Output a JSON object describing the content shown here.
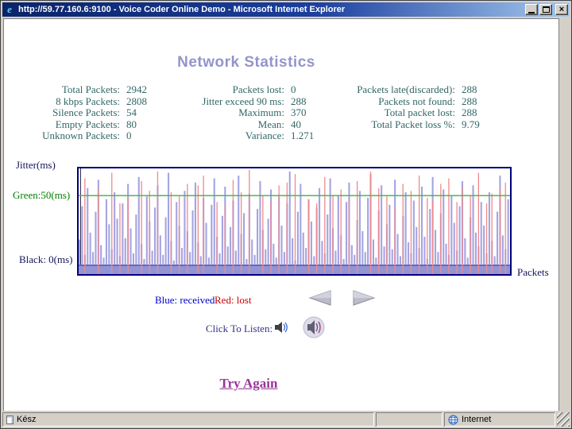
{
  "window": {
    "title": "http://59.77.160.6:9100 - Voice Coder Online Demo - Microsoft Internet Explorer",
    "controls": {
      "close_glyph": "×"
    },
    "icons": {
      "ie_logo_glyph": "e"
    }
  },
  "page": {
    "heading": "Network Statistics",
    "stats": {
      "group1": [
        {
          "label": "Total Packets:",
          "value": "2942"
        },
        {
          "label": "8 kbps Packets:",
          "value": "2808"
        },
        {
          "label": "Silence Packets:",
          "value": "54"
        },
        {
          "label": "Empty Packets:",
          "value": "80"
        },
        {
          "label": "Unknown Packets:",
          "value": "0"
        }
      ],
      "group2": [
        {
          "label": "Packets lost:",
          "value": "0"
        },
        {
          "label": "Jitter exceed 90 ms:",
          "value": "288"
        },
        {
          "label": "Maximum:",
          "value": "370"
        },
        {
          "label": "Mean:",
          "value": "40"
        },
        {
          "label": "Variance:",
          "value": "1.271"
        }
      ],
      "group3": [
        {
          "label": "Packets late(discarded):",
          "value": "288"
        },
        {
          "label": "Packets not found:",
          "value": "288"
        },
        {
          "label": "Total packet lost:",
          "value": "288"
        },
        {
          "label": "Total Packet loss %:",
          "value": "9.79"
        }
      ]
    },
    "chart_labels": {
      "y_axis": "Jitter(ms)",
      "green_ref": "Green:50(ms)",
      "black_ref": "Black: 0(ms)",
      "x_axis": "Packets"
    },
    "legend": {
      "received": "Blue: received",
      "lost": "Red: lost"
    },
    "listen_label": "Click To Listen:",
    "try_again_label": "Try Again"
  },
  "statusbar": {
    "status_text": "Kész",
    "zone_label": "Internet"
  },
  "chart_data": {
    "type": "bar",
    "description": "Per-packet jitter in ms; blue bars = received packets, red lines = lost packets",
    "ylabel": "Jitter(ms)",
    "xlabel": "Packets",
    "ylim": [
      0,
      68
    ],
    "reference_lines": [
      {
        "label": "Green:50(ms)",
        "value": 50,
        "color": "#4db84d"
      },
      {
        "label": "Black: 0(ms)",
        "value": 0,
        "color": "#000000"
      }
    ],
    "series": [
      {
        "name": "received",
        "color": "#9a9ae0",
        "values": [
          18,
          42,
          7,
          55,
          23,
          9,
          38,
          61,
          14,
          5,
          47,
          29,
          11,
          52,
          33,
          6,
          44,
          19,
          58,
          26,
          8,
          36,
          63,
          15,
          4,
          49,
          31,
          10,
          41,
          57,
          21,
          7,
          34,
          66,
          17,
          3,
          45,
          28,
          12,
          53,
          24,
          9,
          39,
          59,
          16,
          6,
          48,
          30,
          5,
          43,
          62,
          20,
          8,
          35,
          56,
          13,
          27,
          46,
          10,
          64,
          22,
          37,
          4,
          51,
          18,
          7,
          40,
          60,
          25,
          11,
          33,
          54,
          15,
          5,
          49,
          28,
          9,
          44,
          67,
          19,
          3,
          38,
          58,
          23,
          12,
          47,
          31,
          6,
          41,
          55,
          17,
          8,
          36,
          62,
          26,
          10,
          50,
          21,
          4,
          45,
          59,
          14,
          7,
          32,
          53,
          24,
          9,
          48,
          65,
          18,
          5,
          39,
          57,
          13,
          29,
          43,
          11,
          61,
          22,
          6,
          35,
          52,
          16,
          8,
          46,
          27,
          12,
          56,
          20,
          4,
          40,
          63,
          25,
          9,
          37,
          54,
          15,
          7,
          50,
          30,
          10,
          42,
          60,
          19,
          5,
          34,
          57,
          23,
          13,
          45,
          28,
          8,
          52,
          17,
          6,
          38,
          64,
          21,
          11,
          47
        ]
      },
      {
        "name": "lost",
        "color": "#ef8a8a",
        "points": [
          [
            2,
            62
          ],
          [
            7,
            55
          ],
          [
            12,
            66
          ],
          [
            15,
            44
          ],
          [
            18,
            48
          ],
          [
            23,
            60
          ],
          [
            26,
            53
          ],
          [
            29,
            67
          ],
          [
            34,
            52
          ],
          [
            37,
            49
          ],
          [
            40,
            58
          ],
          [
            44,
            57
          ],
          [
            46,
            64
          ],
          [
            51,
            45
          ],
          [
            54,
            43
          ],
          [
            57,
            61
          ],
          [
            60,
            52
          ],
          [
            63,
            68
          ],
          [
            68,
            50
          ],
          [
            71,
            46
          ],
          [
            74,
            57
          ],
          [
            77,
            59
          ],
          [
            80,
            65
          ],
          [
            85,
            47
          ],
          [
            88,
            44
          ],
          [
            91,
            63
          ],
          [
            94,
            50
          ],
          [
            97,
            54
          ],
          [
            100,
            47
          ],
          [
            103,
            60
          ],
          [
            108,
            67
          ],
          [
            111,
            55
          ],
          [
            114,
            49
          ],
          [
            117,
            42
          ],
          [
            120,
            58
          ],
          [
            123,
            53
          ],
          [
            126,
            64
          ],
          [
            129,
            48
          ],
          [
            131,
            46
          ],
          [
            134,
            58
          ],
          [
            137,
            62
          ],
          [
            140,
            45
          ],
          [
            142,
            56
          ],
          [
            145,
            50
          ],
          [
            148,
            66
          ],
          [
            151,
            44
          ],
          [
            153,
            51
          ],
          [
            156,
            55
          ],
          [
            158,
            59
          ]
        ]
      }
    ]
  }
}
